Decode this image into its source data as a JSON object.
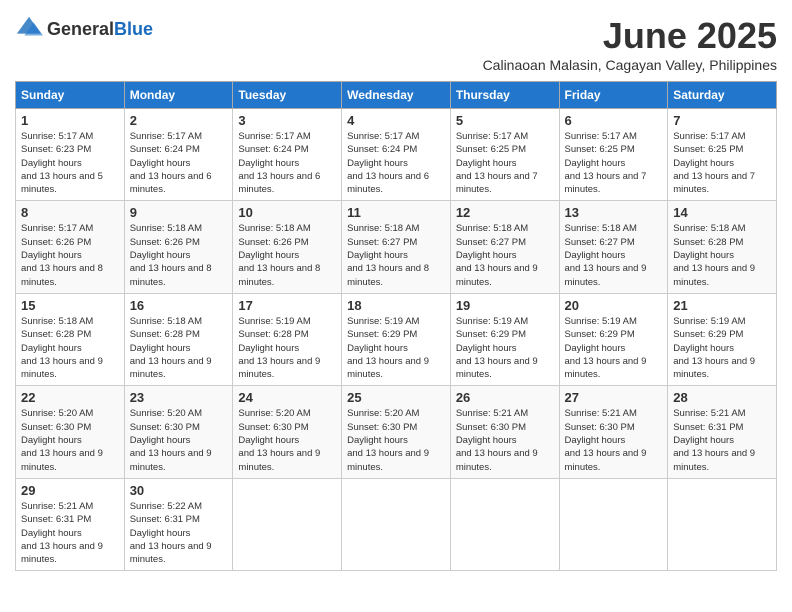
{
  "logo": {
    "text_general": "General",
    "text_blue": "Blue"
  },
  "title": "June 2025",
  "location": "Calinaoan Malasin, Cagayan Valley, Philippines",
  "headers": [
    "Sunday",
    "Monday",
    "Tuesday",
    "Wednesday",
    "Thursday",
    "Friday",
    "Saturday"
  ],
  "weeks": [
    [
      {
        "day": "1",
        "sunrise": "5:17 AM",
        "sunset": "6:23 PM",
        "daylight": "13 hours and 5 minutes."
      },
      {
        "day": "2",
        "sunrise": "5:17 AM",
        "sunset": "6:24 PM",
        "daylight": "13 hours and 6 minutes."
      },
      {
        "day": "3",
        "sunrise": "5:17 AM",
        "sunset": "6:24 PM",
        "daylight": "13 hours and 6 minutes."
      },
      {
        "day": "4",
        "sunrise": "5:17 AM",
        "sunset": "6:24 PM",
        "daylight": "13 hours and 6 minutes."
      },
      {
        "day": "5",
        "sunrise": "5:17 AM",
        "sunset": "6:25 PM",
        "daylight": "13 hours and 7 minutes."
      },
      {
        "day": "6",
        "sunrise": "5:17 AM",
        "sunset": "6:25 PM",
        "daylight": "13 hours and 7 minutes."
      },
      {
        "day": "7",
        "sunrise": "5:17 AM",
        "sunset": "6:25 PM",
        "daylight": "13 hours and 7 minutes."
      }
    ],
    [
      {
        "day": "8",
        "sunrise": "5:17 AM",
        "sunset": "6:26 PM",
        "daylight": "13 hours and 8 minutes."
      },
      {
        "day": "9",
        "sunrise": "5:18 AM",
        "sunset": "6:26 PM",
        "daylight": "13 hours and 8 minutes."
      },
      {
        "day": "10",
        "sunrise": "5:18 AM",
        "sunset": "6:26 PM",
        "daylight": "13 hours and 8 minutes."
      },
      {
        "day": "11",
        "sunrise": "5:18 AM",
        "sunset": "6:27 PM",
        "daylight": "13 hours and 8 minutes."
      },
      {
        "day": "12",
        "sunrise": "5:18 AM",
        "sunset": "6:27 PM",
        "daylight": "13 hours and 9 minutes."
      },
      {
        "day": "13",
        "sunrise": "5:18 AM",
        "sunset": "6:27 PM",
        "daylight": "13 hours and 9 minutes."
      },
      {
        "day": "14",
        "sunrise": "5:18 AM",
        "sunset": "6:28 PM",
        "daylight": "13 hours and 9 minutes."
      }
    ],
    [
      {
        "day": "15",
        "sunrise": "5:18 AM",
        "sunset": "6:28 PM",
        "daylight": "13 hours and 9 minutes."
      },
      {
        "day": "16",
        "sunrise": "5:18 AM",
        "sunset": "6:28 PM",
        "daylight": "13 hours and 9 minutes."
      },
      {
        "day": "17",
        "sunrise": "5:19 AM",
        "sunset": "6:28 PM",
        "daylight": "13 hours and 9 minutes."
      },
      {
        "day": "18",
        "sunrise": "5:19 AM",
        "sunset": "6:29 PM",
        "daylight": "13 hours and 9 minutes."
      },
      {
        "day": "19",
        "sunrise": "5:19 AM",
        "sunset": "6:29 PM",
        "daylight": "13 hours and 9 minutes."
      },
      {
        "day": "20",
        "sunrise": "5:19 AM",
        "sunset": "6:29 PM",
        "daylight": "13 hours and 9 minutes."
      },
      {
        "day": "21",
        "sunrise": "5:19 AM",
        "sunset": "6:29 PM",
        "daylight": "13 hours and 9 minutes."
      }
    ],
    [
      {
        "day": "22",
        "sunrise": "5:20 AM",
        "sunset": "6:30 PM",
        "daylight": "13 hours and 9 minutes."
      },
      {
        "day": "23",
        "sunrise": "5:20 AM",
        "sunset": "6:30 PM",
        "daylight": "13 hours and 9 minutes."
      },
      {
        "day": "24",
        "sunrise": "5:20 AM",
        "sunset": "6:30 PM",
        "daylight": "13 hours and 9 minutes."
      },
      {
        "day": "25",
        "sunrise": "5:20 AM",
        "sunset": "6:30 PM",
        "daylight": "13 hours and 9 minutes."
      },
      {
        "day": "26",
        "sunrise": "5:21 AM",
        "sunset": "6:30 PM",
        "daylight": "13 hours and 9 minutes."
      },
      {
        "day": "27",
        "sunrise": "5:21 AM",
        "sunset": "6:30 PM",
        "daylight": "13 hours and 9 minutes."
      },
      {
        "day": "28",
        "sunrise": "5:21 AM",
        "sunset": "6:31 PM",
        "daylight": "13 hours and 9 minutes."
      }
    ],
    [
      {
        "day": "29",
        "sunrise": "5:21 AM",
        "sunset": "6:31 PM",
        "daylight": "13 hours and 9 minutes."
      },
      {
        "day": "30",
        "sunrise": "5:22 AM",
        "sunset": "6:31 PM",
        "daylight": "13 hours and 9 minutes."
      },
      null,
      null,
      null,
      null,
      null
    ]
  ],
  "labels": {
    "sunrise": "Sunrise:",
    "sunset": "Sunset:",
    "daylight": "Daylight hours"
  }
}
